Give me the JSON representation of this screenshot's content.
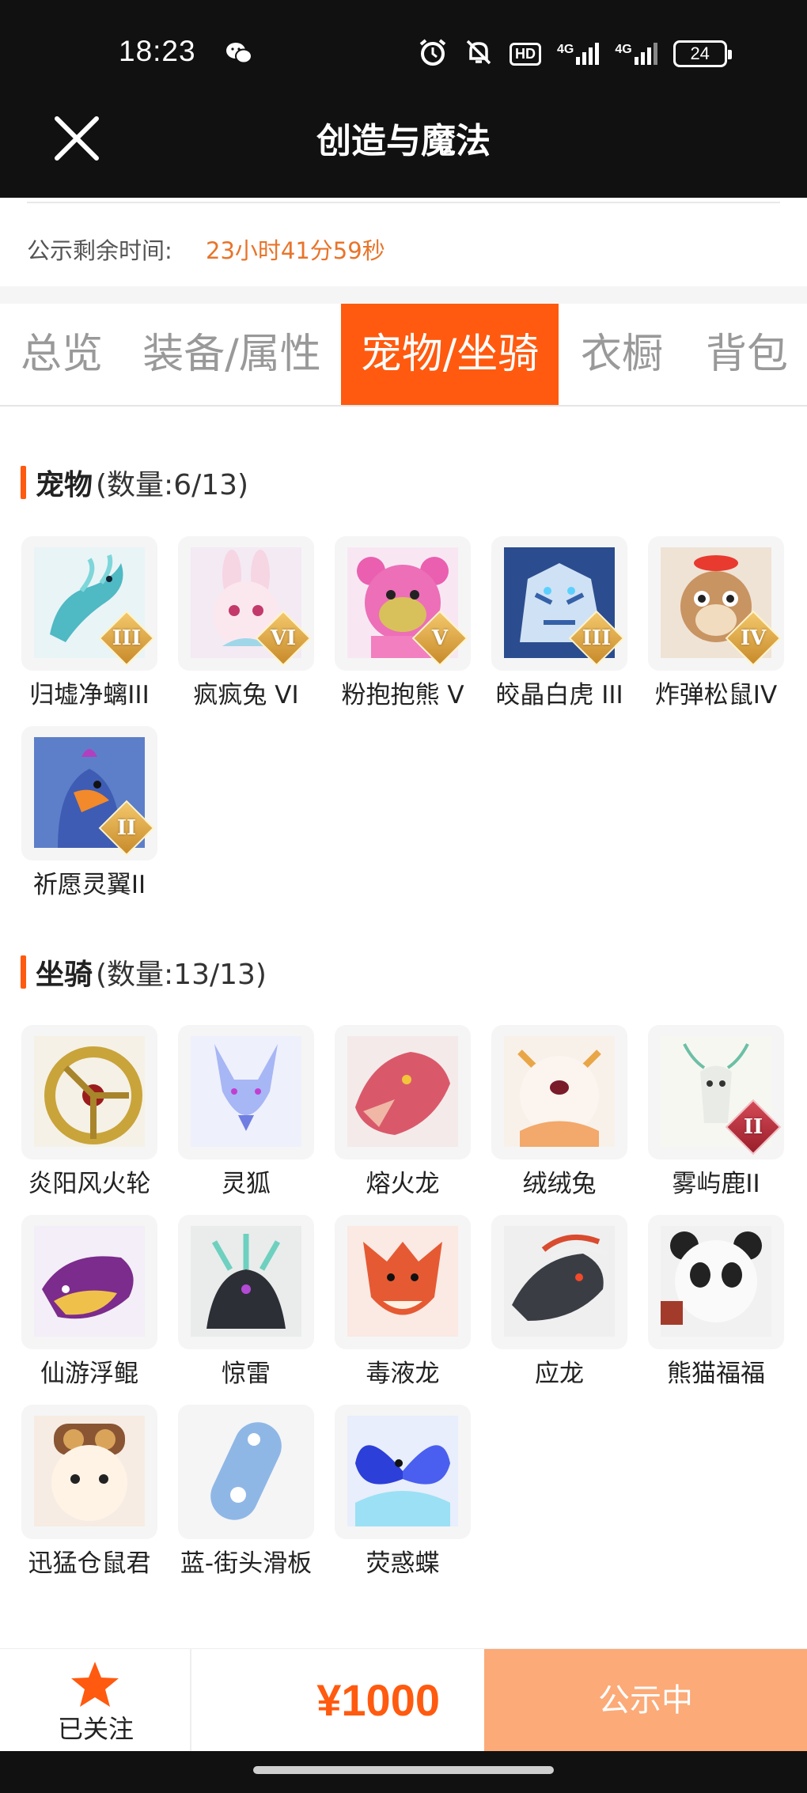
{
  "status_bar": {
    "time": "18:23",
    "icons": [
      "wechat-icon",
      "alarm-icon",
      "mute-icon",
      "hd-icon",
      "signal-4g-icon",
      "signal-4g-icon",
      "battery-icon"
    ],
    "hd_label": "HD",
    "net_label_1": "4G",
    "net_label_2": "4G",
    "battery": "24"
  },
  "header": {
    "title": "创造与魔法",
    "close_icon": "close-icon"
  },
  "notice": {
    "label": "公示剩余时间:",
    "value": "23小时41分59秒",
    "value_color": "#e8742a"
  },
  "tabs": [
    {
      "label": "总览",
      "active": false
    },
    {
      "label": "装备/属性",
      "active": false
    },
    {
      "label": "宠物/坐骑",
      "active": true
    },
    {
      "label": "衣橱",
      "active": false
    },
    {
      "label": "背包",
      "active": false
    }
  ],
  "accent_color": "#ff5a0f",
  "pets": {
    "title": "宠物",
    "count": "(数量:6/13)",
    "items": [
      {
        "name": "归墟净螭III",
        "badge": "III"
      },
      {
        "name": "疯疯兔 VI",
        "badge": "VI"
      },
      {
        "name": "粉抱抱熊 V",
        "badge": "V"
      },
      {
        "name": "皎晶白虎 III",
        "badge": "III"
      },
      {
        "name": "炸弹松鼠IV",
        "badge": "IV"
      },
      {
        "name": "祈愿灵翼II",
        "badge": "II"
      }
    ]
  },
  "mounts": {
    "title": "坐骑",
    "count": "(数量:13/13)",
    "items": [
      {
        "name": "炎阳风火轮"
      },
      {
        "name": "灵狐"
      },
      {
        "name": "熔火龙"
      },
      {
        "name": "绒绒兔"
      },
      {
        "name": "雾屿鹿II",
        "badge": "II"
      },
      {
        "name": "仙游浮鲲"
      },
      {
        "name": "惊雷"
      },
      {
        "name": "毒液龙"
      },
      {
        "name": "应龙"
      },
      {
        "name": "熊猫福福"
      },
      {
        "name": "迅猛仓鼠君"
      },
      {
        "name": "蓝-街头滑板"
      },
      {
        "name": "荧惑蝶"
      }
    ]
  },
  "bottom_bar": {
    "follow_label": "已关注",
    "price": "¥1000",
    "status_button": "公示中",
    "star_color": "#ff5a0f",
    "button_color": "#fbaa78"
  }
}
